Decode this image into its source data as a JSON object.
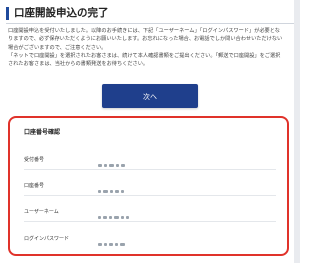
{
  "page_title": "口座開設申込の完了",
  "description": [
    "口座開設申込を受付いたしました。以降のお手続きには、下記「ユーザーネーム」「ログインパスワード」が必要とな",
    "りますので、必ず保存いただくようにお願いいたします。お忘れになった場合、お電話でしか問い合わせいただけない",
    "場合がございますので、ご注意ください。",
    "「ネットで口座開設」を選択されたお客さまは、続けて本人確認書類をご提出ください。「郵送で口座開設」をご選択",
    "されたお客さまは、当社からの書類発送をお待ちください。"
  ],
  "next_button_label": "次へ",
  "confirmation": {
    "title": "口座番号確認",
    "fields": [
      {
        "label": "受付番号",
        "value": ""
      },
      {
        "label": "口座番号",
        "value": ""
      },
      {
        "label": "ユーザーネーム",
        "value": ""
      },
      {
        "label": "ログインパスワード",
        "value": ""
      }
    ]
  },
  "colors": {
    "accent": "#1f3f8c",
    "highlight_border": "#e0322a"
  }
}
